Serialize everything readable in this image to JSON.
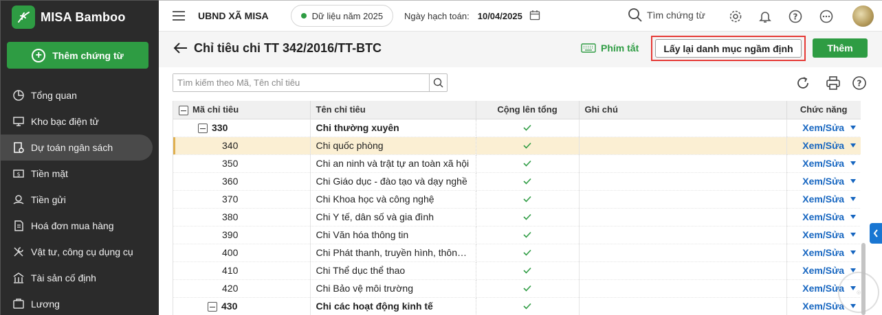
{
  "app": {
    "name": "MISA Bamboo",
    "add_doc_label": "Thêm chứng từ"
  },
  "sidebar": {
    "items": [
      {
        "label": "Tổng quan",
        "icon": "chart-pie-icon",
        "active": false
      },
      {
        "label": "Kho bạc điện tử",
        "icon": "monitor-icon",
        "active": false
      },
      {
        "label": "Dự toán ngân sách",
        "icon": "budget-doc-icon",
        "active": true
      },
      {
        "label": "Tiền mặt",
        "icon": "cash-icon",
        "active": false
      },
      {
        "label": "Tiền gửi",
        "icon": "deposit-icon",
        "active": false
      },
      {
        "label": "Hoá đơn mua hàng",
        "icon": "invoice-icon",
        "active": false
      },
      {
        "label": "Vật tư, công cụ dụng cụ",
        "icon": "tools-icon",
        "active": false
      },
      {
        "label": "Tài sản cố định",
        "icon": "building-icon",
        "active": false
      },
      {
        "label": "Lương",
        "icon": "salary-icon",
        "active": false
      }
    ]
  },
  "topbar": {
    "org_name": "UBND XÃ MISA",
    "data_year": "Dữ liệu năm 2025",
    "accounting_date_label": "Ngày hạch toán:",
    "accounting_date": "10/04/2025",
    "search_label": "Tìm chứng từ"
  },
  "page": {
    "title": "Chỉ tiêu chi TT 342/2016/TT-BTC",
    "shortcut_label": "Phím tắt",
    "reset_label": "Lấy lại danh mục ngầm định",
    "add_label": "Thêm",
    "search_placeholder": "Tìm kiếm theo Mã, Tên chỉ tiêu"
  },
  "table": {
    "columns": [
      "Mã chỉ tiêu",
      "Tên chỉ tiêu",
      "Cộng lên tổng",
      "Ghi chú",
      "Chức năng"
    ],
    "func_label": "Xem/Sửa",
    "rows": [
      {
        "code": "330",
        "name": "Chi thường xuyên",
        "sum": true,
        "note": "",
        "group": true,
        "level": 1
      },
      {
        "code": "340",
        "name": "Chi quốc phòng",
        "sum": true,
        "note": "",
        "level": 2,
        "selected": true
      },
      {
        "code": "350",
        "name": "Chi an ninh và trật tự an toàn xã hội",
        "sum": true,
        "note": "",
        "level": 2
      },
      {
        "code": "360",
        "name": "Chi Giáo dục - đào tạo và dạy nghề",
        "sum": true,
        "note": "",
        "level": 2
      },
      {
        "code": "370",
        "name": "Chi Khoa học và công nghệ",
        "sum": true,
        "note": "",
        "level": 2
      },
      {
        "code": "380",
        "name": "Chi Y tế, dân số và gia đình",
        "sum": true,
        "note": "",
        "level": 2
      },
      {
        "code": "390",
        "name": "Chi Văn hóa thông tin",
        "sum": true,
        "note": "",
        "level": 2
      },
      {
        "code": "400",
        "name": "Chi Phát thanh, truyền hình, thông tấn",
        "sum": true,
        "note": "",
        "level": 2
      },
      {
        "code": "410",
        "name": "Chi Thể dục thể thao",
        "sum": true,
        "note": "",
        "level": 2
      },
      {
        "code": "420",
        "name": "Chi Bảo vệ môi trường",
        "sum": true,
        "note": "",
        "level": 2
      },
      {
        "code": "430",
        "name": "Chi các hoạt động kinh tế",
        "sum": true,
        "note": "",
        "group": true,
        "level": 2
      }
    ]
  },
  "colors": {
    "brand_green": "#2e9c43",
    "link_blue": "#1565c0",
    "selected_row": "#fbefd3",
    "highlight_red": "#e53935"
  }
}
